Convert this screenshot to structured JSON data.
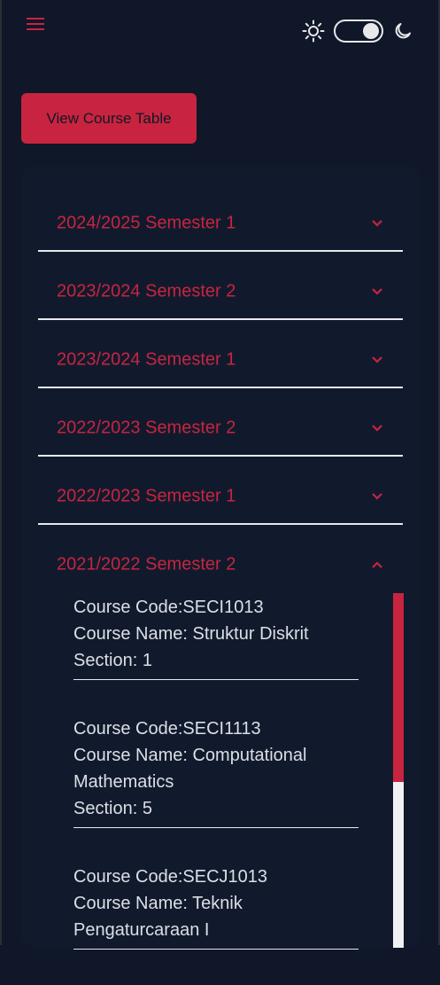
{
  "header": {
    "menu_icon": "hamburger-icon",
    "light_icon": "sun-icon",
    "dark_icon": "moon-icon",
    "theme": "dark"
  },
  "actions": {
    "view_course_table": "View Course Table"
  },
  "semesters": [
    {
      "label": "2024/2025 Semester 1",
      "expanded": false
    },
    {
      "label": "2023/2024 Semester 2",
      "expanded": false
    },
    {
      "label": "2023/2024 Semester 1",
      "expanded": false
    },
    {
      "label": "2022/2023 Semester 2",
      "expanded": false
    },
    {
      "label": "2022/2023 Semester 1",
      "expanded": false
    },
    {
      "label": "2021/2022 Semester 2",
      "expanded": true
    }
  ],
  "courses": [
    {
      "code": "Course Code:SECI1013",
      "name": "Course Name: Struktur Diskrit",
      "section": "Section: 1"
    },
    {
      "code": "Course Code:SECI1113",
      "name": "Course Name: Computational Mathematics",
      "section": "Section: 5"
    },
    {
      "code": "Course Code:SECJ1013",
      "name": "Course Name: Teknik Pengaturcaraan I",
      "section": ""
    }
  ],
  "colors": {
    "accent": "#c8243f",
    "background": "#0f1729",
    "text": "#dcdfe5"
  }
}
